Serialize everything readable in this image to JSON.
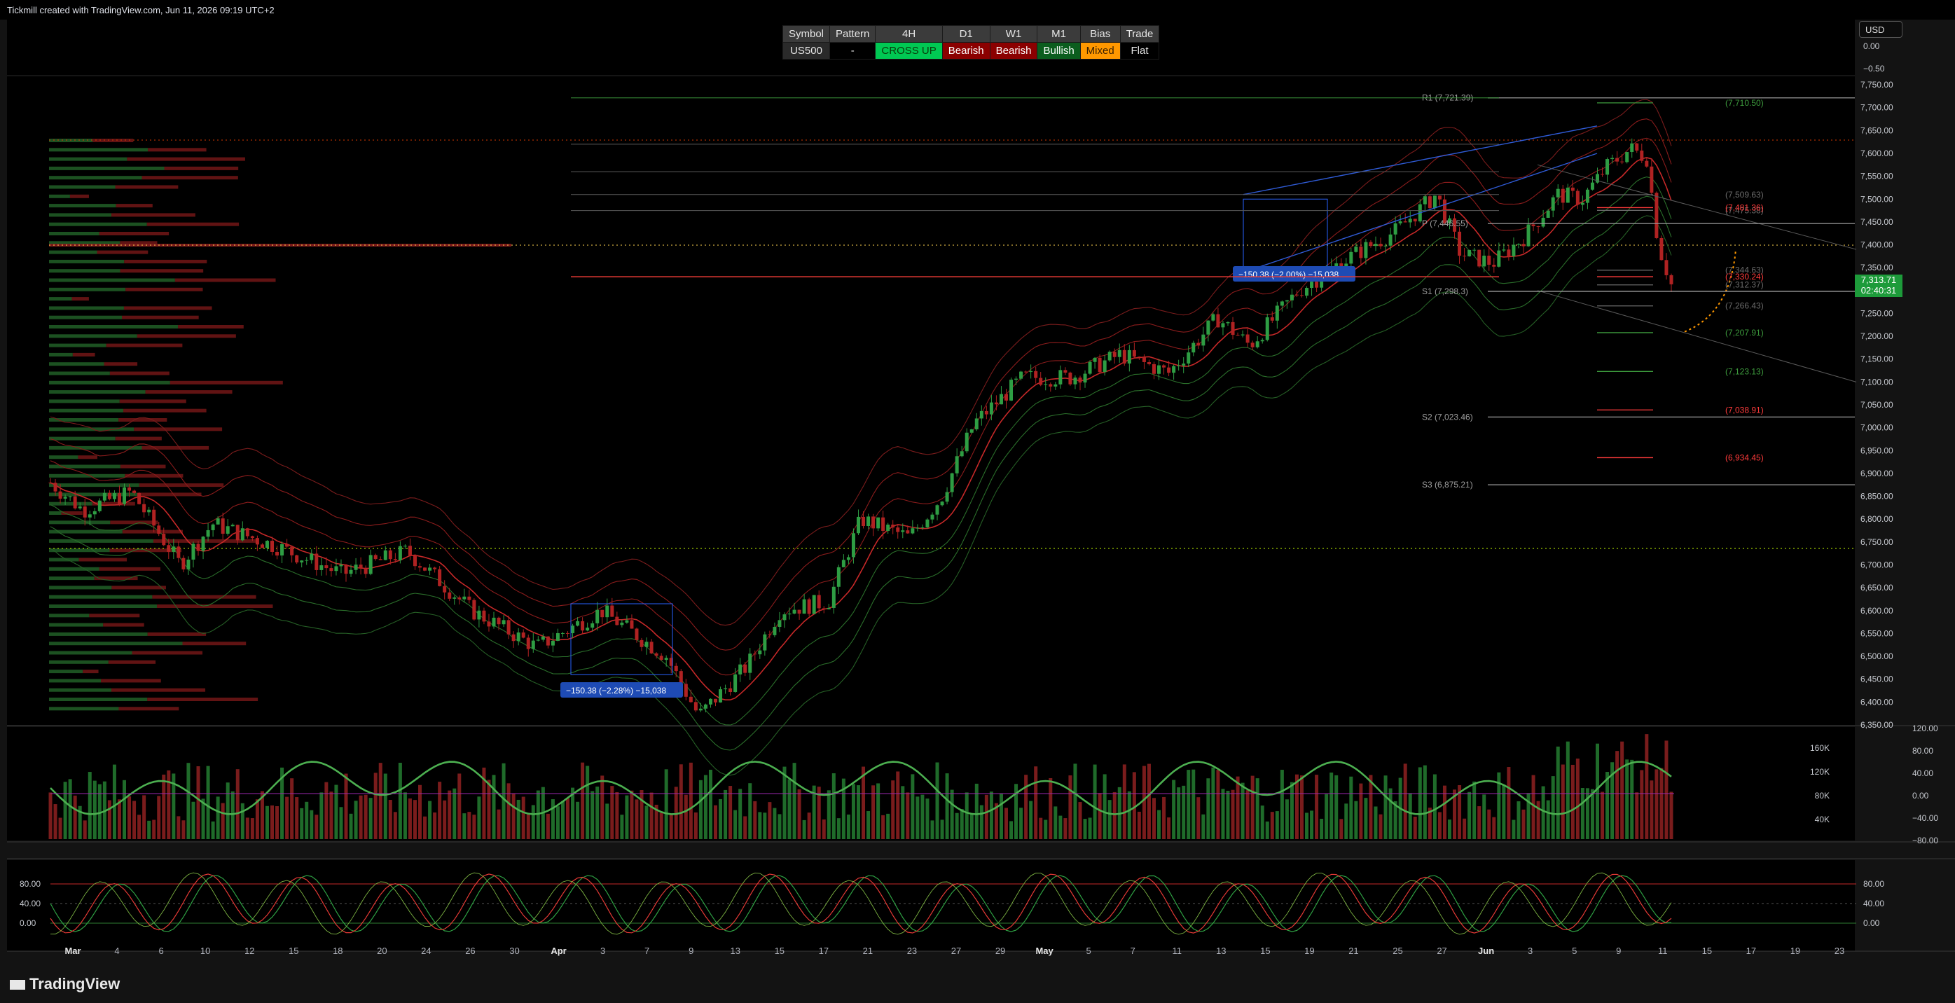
{
  "header": {
    "title": "Tickmill created with TradingView.com, Jun 11, 2026 09:19 UTC+2"
  },
  "status_table": {
    "headers": [
      "Symbol",
      "Pattern",
      "4H",
      "D1",
      "W1",
      "M1",
      "Bias",
      "Trade"
    ],
    "cells": [
      {
        "text": "US500",
        "bg": "#2a2a2a",
        "fg": "#e6e6e6"
      },
      {
        "text": "-",
        "bg": "#000000",
        "fg": "#e6e6e6"
      },
      {
        "text": "CROSS UP",
        "bg": "#00c853",
        "fg": "#0a3a0a"
      },
      {
        "text": "Bearish",
        "bg": "#8b0000",
        "fg": "#ffffff"
      },
      {
        "text": "Bearish",
        "bg": "#8b0000",
        "fg": "#ffffff"
      },
      {
        "text": "Bullish",
        "bg": "#0b5d1e",
        "fg": "#ffffff"
      },
      {
        "text": "Mixed",
        "bg": "#ff9800",
        "fg": "#3a2000"
      },
      {
        "text": "Flat",
        "bg": "#000000",
        "fg": "#e6e6e6"
      }
    ]
  },
  "currency": "USD",
  "brand": "TradingView",
  "price_tag": {
    "price": "7,313.71",
    "countdown": "02:40:31"
  },
  "colors": {
    "bull": "#2e9d43",
    "bear": "#b02222",
    "background": "#000000"
  },
  "chart_data": [
    {
      "type": "candlestick",
      "symbol": "US500",
      "timeframe": "4H",
      "y_axis": {
        "range": [
          6350,
          7770
        ],
        "ticks": [
          "7,750.00",
          "7,700.00",
          "7,650.00",
          "7,600.00",
          "7,550.00",
          "7,500.00",
          "7,450.00",
          "7,400.00",
          "7,350.00",
          "7,300.00",
          "7,250.00",
          "7,200.00",
          "7,150.00",
          "7,100.00",
          "7,050.00",
          "7,000.00",
          "6,950.00",
          "6,900.00",
          "6,850.00",
          "6,800.00",
          "6,750.00",
          "6,700.00",
          "6,650.00",
          "6,600.00",
          "6,550.00",
          "6,500.00",
          "6,450.00",
          "6,400.00",
          "6,350.00"
        ],
        "top_labels": [
          "0.00",
          "−0.50"
        ]
      },
      "x_axis": {
        "ticks": [
          {
            "label": "Mar",
            "bold": true
          },
          {
            "label": "4"
          },
          {
            "label": "6"
          },
          {
            "label": "10"
          },
          {
            "label": "12"
          },
          {
            "label": "15"
          },
          {
            "label": "18"
          },
          {
            "label": "20"
          },
          {
            "label": "24"
          },
          {
            "label": "26"
          },
          {
            "label": "30"
          },
          {
            "label": "Apr",
            "bold": true
          },
          {
            "label": "3"
          },
          {
            "label": "7"
          },
          {
            "label": "9"
          },
          {
            "label": "13"
          },
          {
            "label": "15"
          },
          {
            "label": "17"
          },
          {
            "label": "21"
          },
          {
            "label": "23"
          },
          {
            "label": "27"
          },
          {
            "label": "29"
          },
          {
            "label": "May",
            "bold": true
          },
          {
            "label": "5"
          },
          {
            "label": "7"
          },
          {
            "label": "11"
          },
          {
            "label": "13"
          },
          {
            "label": "15"
          },
          {
            "label": "19"
          },
          {
            "label": "21"
          },
          {
            "label": "25"
          },
          {
            "label": "27"
          },
          {
            "label": "Jun",
            "bold": true
          },
          {
            "label": "3"
          },
          {
            "label": "5"
          },
          {
            "label": "9"
          },
          {
            "label": "11"
          },
          {
            "label": "15"
          },
          {
            "label": "17"
          },
          {
            "label": "19"
          },
          {
            "label": "23"
          }
        ]
      },
      "path_anchors": [
        [
          0,
          6880
        ],
        [
          0.02,
          6820
        ],
        [
          0.05,
          6860
        ],
        [
          0.08,
          6700
        ],
        [
          0.1,
          6790
        ],
        [
          0.14,
          6740
        ],
        [
          0.18,
          6680
        ],
        [
          0.22,
          6730
        ],
        [
          0.26,
          6600
        ],
        [
          0.3,
          6520
        ],
        [
          0.34,
          6600
        ],
        [
          0.38,
          6500
        ],
        [
          0.4,
          6370
        ],
        [
          0.43,
          6480
        ],
        [
          0.45,
          6600
        ],
        [
          0.48,
          6620
        ],
        [
          0.5,
          6800
        ],
        [
          0.53,
          6760
        ],
        [
          0.55,
          6850
        ],
        [
          0.57,
          7010
        ],
        [
          0.6,
          7110
        ],
        [
          0.63,
          7110
        ],
        [
          0.66,
          7160
        ],
        [
          0.69,
          7120
        ],
        [
          0.72,
          7240
        ],
        [
          0.74,
          7180
        ],
        [
          0.77,
          7300
        ],
        [
          0.8,
          7370
        ],
        [
          0.83,
          7430
        ],
        [
          0.855,
          7510
        ],
        [
          0.87,
          7380
        ],
        [
          0.89,
          7360
        ],
        [
          0.91,
          7420
        ],
        [
          0.93,
          7510
        ],
        [
          0.945,
          7500
        ],
        [
          0.96,
          7570
        ],
        [
          0.975,
          7610
        ],
        [
          0.985,
          7590
        ],
        [
          0.992,
          7400
        ],
        [
          1.0,
          7313
        ]
      ],
      "levels": [
        {
          "label": "R1 (7,721.39)",
          "price": 7721.39,
          "color": "#9e9e9e"
        },
        {
          "label": "(7,710.50)",
          "price": 7710.5,
          "color": "#3d9b3d"
        },
        {
          "label": "(7,509.63)",
          "price": 7509.63,
          "color": "#6b6b6b"
        },
        {
          "label": "(7,475.38)",
          "price": 7475.38,
          "color": "#6b6b6b"
        },
        {
          "label": "(7,481.36)",
          "price": 7481.36,
          "color": "#ff3b3b"
        },
        {
          "label": "P (7,446.55)",
          "price": 7446.55,
          "color": "#9e9e9e"
        },
        {
          "label": "(7,344.63)",
          "price": 7344.63,
          "color": "#6b6b6b"
        },
        {
          "label": "(7,330.24)",
          "price": 7330.24,
          "color": "#ff3b3b"
        },
        {
          "label": "(7,312.37)",
          "price": 7312.37,
          "color": "#6b6b6b"
        },
        {
          "label": "S1 (7,298.3)",
          "price": 7298.3,
          "color": "#9e9e9e"
        },
        {
          "label": "(7,266.43)",
          "price": 7266.43,
          "color": "#6b6b6b"
        },
        {
          "label": "(7,207.91)",
          "price": 7207.91,
          "color": "#3d9b3d"
        },
        {
          "label": "(7,123.13)",
          "price": 7123.13,
          "color": "#3d9b3d"
        },
        {
          "label": "(7,038.91)",
          "price": 7038.91,
          "color": "#ff3b3b"
        },
        {
          "label": "S2 (7,023.46)",
          "price": 7023.46,
          "color": "#9e9e9e"
        },
        {
          "label": "(6,934.45)",
          "price": 6934.45,
          "color": "#ff3b3b"
        },
        {
          "label": "S3 (6,875.21)",
          "price": 6875.21,
          "color": "#9e9e9e"
        }
      ],
      "measurements": [
        {
          "label": "−150.38 (−2.28%) −15,038"
        },
        {
          "label": "−150.38 (−2.00%) −15,038"
        }
      ]
    },
    {
      "type": "bar",
      "name": "volume",
      "y_axis_left": [
        "160K",
        "120K",
        "80K",
        "40K"
      ],
      "y_axis_right": [
        "120.00",
        "80.00",
        "40.00",
        "0.00",
        "−40.00",
        "−80.00"
      ]
    },
    {
      "type": "line",
      "name": "stochastic",
      "y_axis_left": [
        "80.00",
        "40.00",
        "0.00"
      ],
      "y_axis_right": [
        "80.00",
        "40.00",
        "0.00"
      ]
    }
  ]
}
